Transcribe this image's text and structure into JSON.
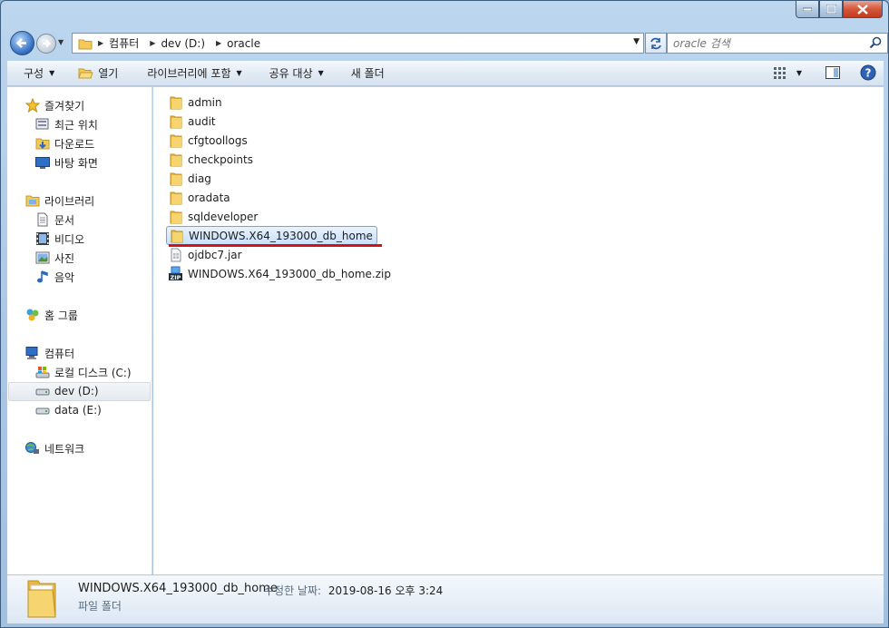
{
  "address": {
    "crumbs": [
      "컴퓨터",
      "dev (D:)",
      "oracle"
    ]
  },
  "search": {
    "placeholder": "oracle 검색"
  },
  "toolbar": {
    "organize": "구성",
    "open": "열기",
    "include_library": "라이브러리에 포함",
    "share": "공유 대상",
    "new_folder": "새 폴더"
  },
  "sidebar": {
    "favorites": {
      "label": "즐겨찾기",
      "items": [
        "최근 위치",
        "다운로드",
        "바탕 화면"
      ]
    },
    "libraries": {
      "label": "라이브러리",
      "items": [
        "문서",
        "비디오",
        "사진",
        "음악"
      ]
    },
    "homegroup": {
      "label": "홈 그룹"
    },
    "computer": {
      "label": "컴퓨터",
      "items": [
        "로컬 디스크 (C:)",
        "dev (D:)",
        "data (E:)"
      ]
    },
    "network": {
      "label": "네트워크"
    },
    "selected": "dev (D:)"
  },
  "files": [
    {
      "name": "admin",
      "type": "folder"
    },
    {
      "name": "audit",
      "type": "folder"
    },
    {
      "name": "cfgtoollogs",
      "type": "folder"
    },
    {
      "name": "checkpoints",
      "type": "folder"
    },
    {
      "name": "diag",
      "type": "folder"
    },
    {
      "name": "oradata",
      "type": "folder"
    },
    {
      "name": "sqldeveloper",
      "type": "folder"
    },
    {
      "name": "WINDOWS.X64_193000_db_home",
      "type": "folder",
      "selected": true
    },
    {
      "name": "ojdbc7.jar",
      "type": "jar"
    },
    {
      "name": "WINDOWS.X64_193000_db_home.zip",
      "type": "zip"
    }
  ],
  "details": {
    "name": "WINDOWS.X64_193000_db_home",
    "modified_label": "수정한 날짜:",
    "modified_value": "2019-08-16 오후 3:24",
    "type": "파일 폴더"
  },
  "colors": {
    "selection_bg": "#cce4fb",
    "highlight_underline": "#d0121a",
    "folder": "#f3c95a"
  }
}
